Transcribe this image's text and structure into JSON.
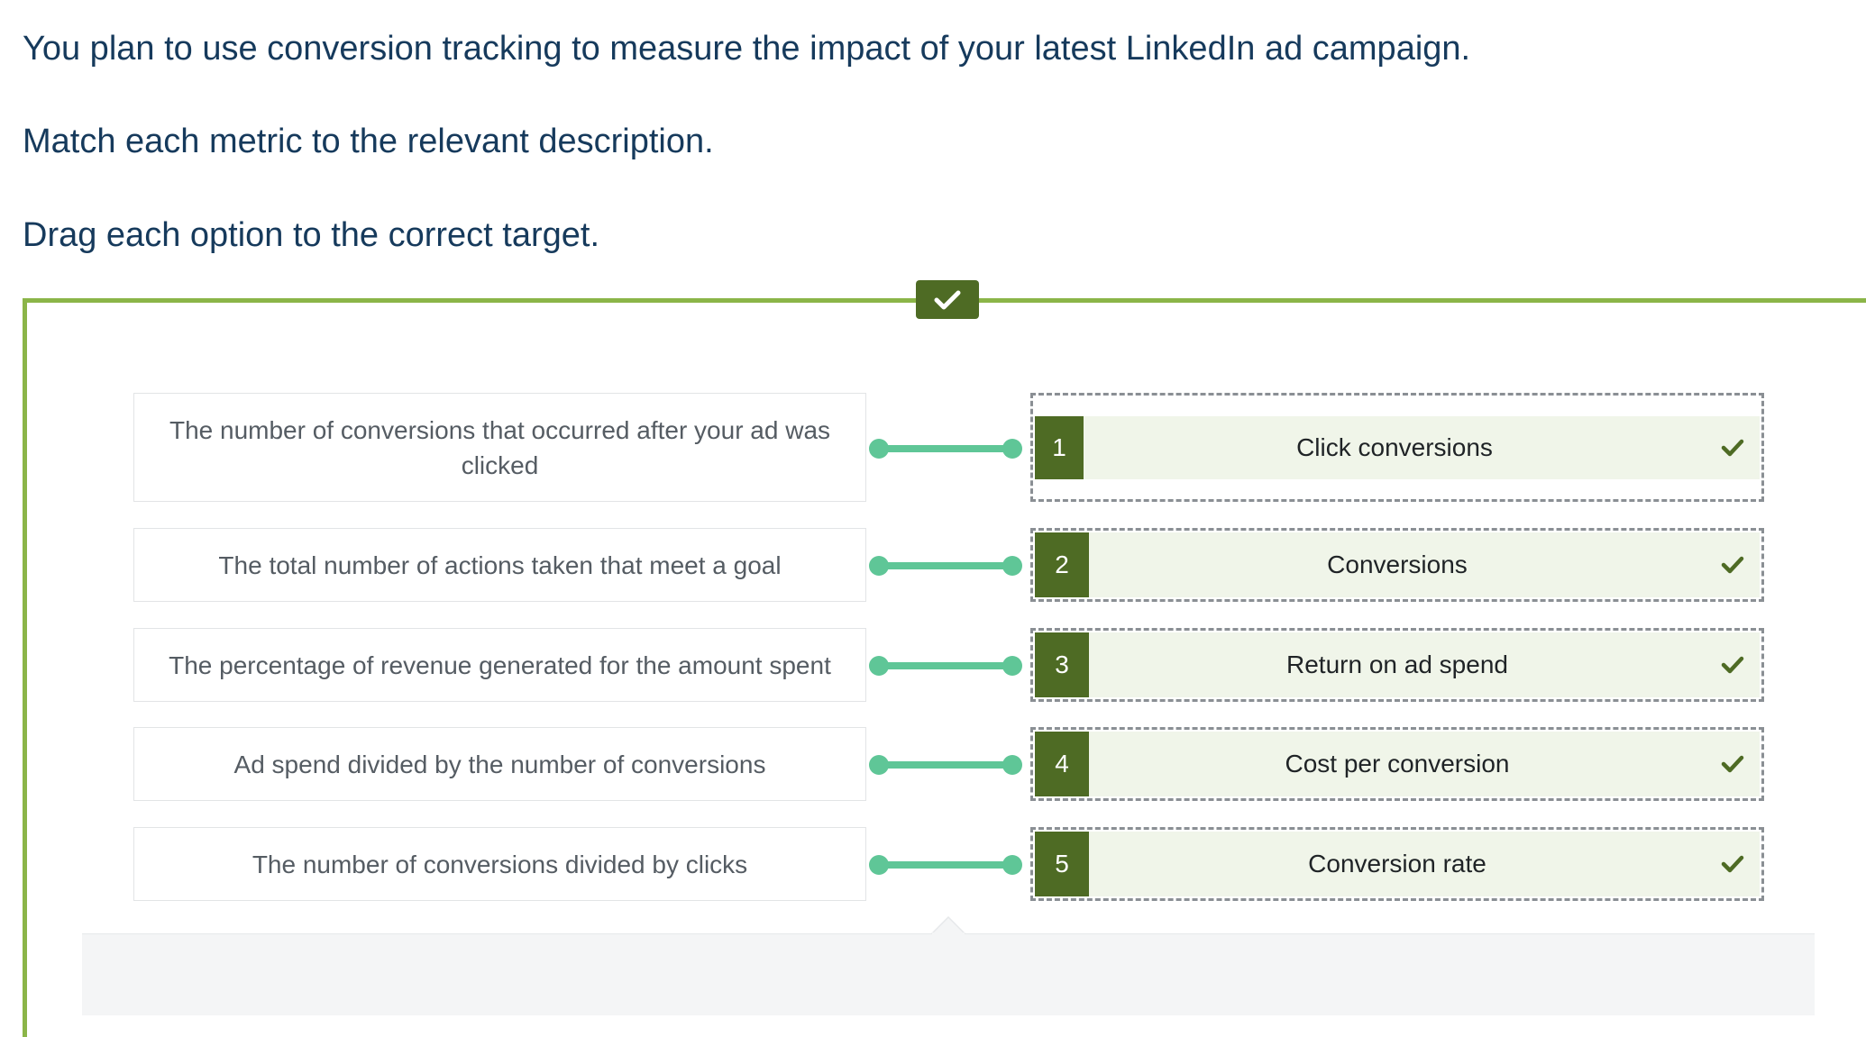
{
  "instructions": {
    "line1": "You plan to use conversion tracking to measure the impact of your latest LinkedIn ad campaign.",
    "line2": "Match each metric to the relevant description.",
    "line3": "Drag each option to the correct target."
  },
  "status": {
    "icon": "check-icon",
    "state": "correct"
  },
  "pairs": [
    {
      "description": "The number of conversions that occurred after your ad was clicked",
      "number": "1",
      "answer": "Click conversions"
    },
    {
      "description": "The total number of actions taken that meet a goal",
      "number": "2",
      "answer": "Conversions"
    },
    {
      "description": "The percentage of revenue generated for the amount spent",
      "number": "3",
      "answer": "Return on ad spend"
    },
    {
      "description": "Ad spend divided by the number of conversions",
      "number": "4",
      "answer": "Cost per conversion"
    },
    {
      "description": "The number of conversions divided by clicks",
      "number": "5",
      "answer": "Conversion rate"
    }
  ],
  "colors": {
    "frame": "#8bb548",
    "dark_green": "#4e6b24",
    "answer_bg": "#f0f5e9",
    "connector": "#5fc697",
    "text_blue": "#163a5c"
  }
}
